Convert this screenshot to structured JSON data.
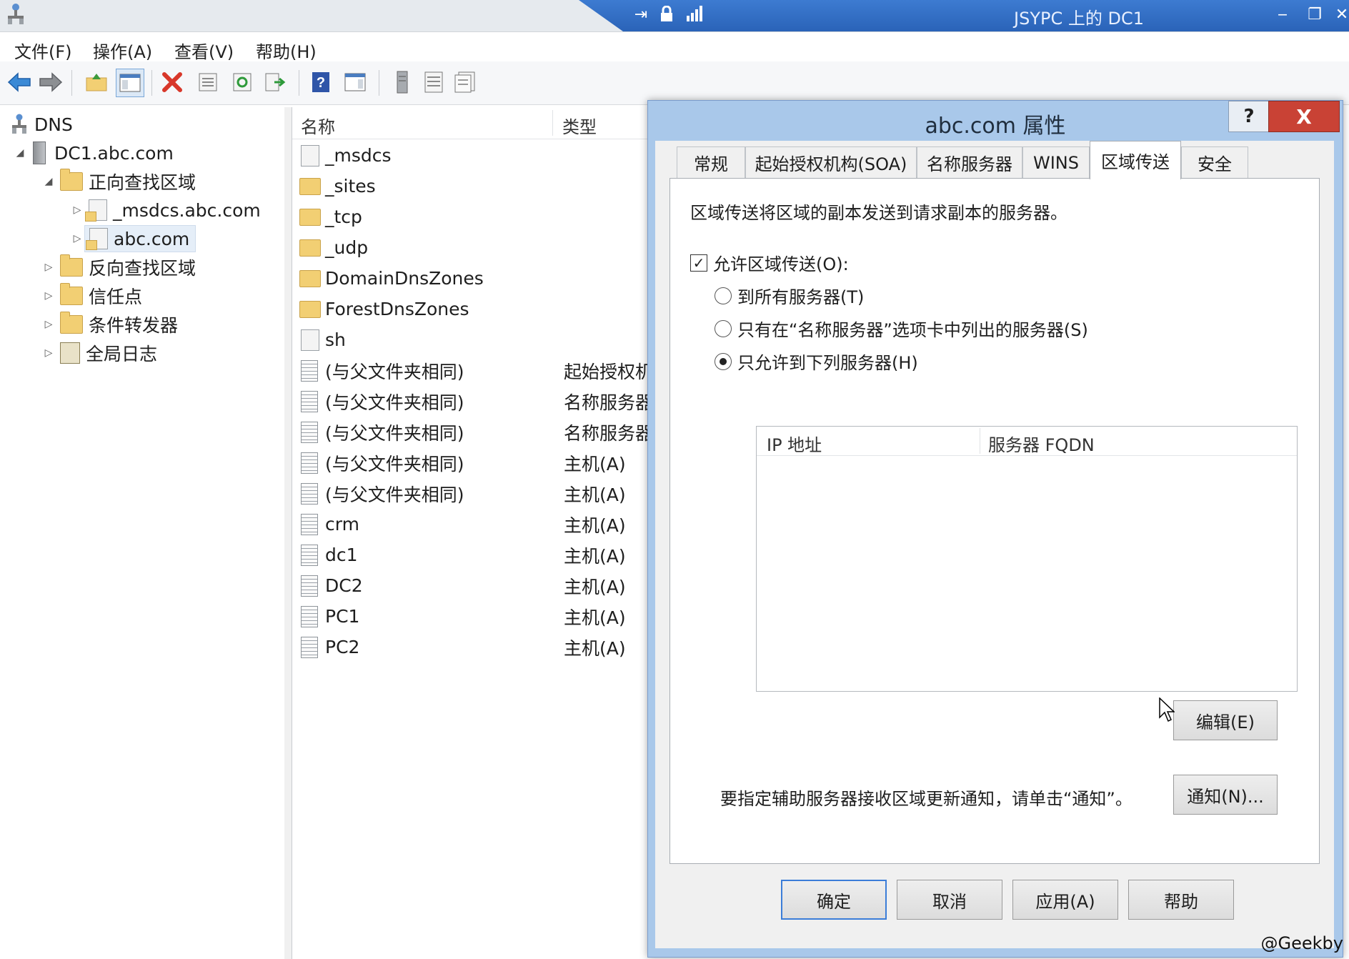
{
  "window": {
    "remote_title": "JSYPC 上的 DC1"
  },
  "menu": [
    "文件(F)",
    "操作(A)",
    "查看(V)",
    "帮助(H)"
  ],
  "toolbar": {
    "icons": [
      "back-icon",
      "forward-icon",
      "up-folder-icon",
      "show-hide-tree-icon",
      "delete-icon",
      "properties-icon",
      "refresh-icon",
      "export-icon",
      "help-icon",
      "action-pane-icon",
      "server-icon",
      "list-icon",
      "detail-icon"
    ]
  },
  "tree": {
    "root": "DNS",
    "server": "DC1.abc.com",
    "forward_zones": "正向查找区域",
    "msdcs_zone": "_msdcs.abc.com",
    "abc_zone": "abc.com",
    "reverse_zones": "反向查找区域",
    "trust_points": "信任点",
    "conditional_forwarders": "条件转发器",
    "global_logs": "全局日志"
  },
  "list": {
    "columns": [
      "名称",
      "类型"
    ],
    "rows": [
      {
        "name": "_msdcs",
        "type": "",
        "icon": "zone"
      },
      {
        "name": "_sites",
        "type": "",
        "icon": "folder"
      },
      {
        "name": "_tcp",
        "type": "",
        "icon": "folder"
      },
      {
        "name": "_udp",
        "type": "",
        "icon": "folder"
      },
      {
        "name": "DomainDnsZones",
        "type": "",
        "icon": "folder"
      },
      {
        "name": "ForestDnsZones",
        "type": "",
        "icon": "folder"
      },
      {
        "name": "sh",
        "type": "",
        "icon": "zone"
      },
      {
        "name": "(与父文件夹相同)",
        "type": "起始授权机",
        "icon": "record"
      },
      {
        "name": "(与父文件夹相同)",
        "type": "名称服务器",
        "icon": "record"
      },
      {
        "name": "(与父文件夹相同)",
        "type": "名称服务器",
        "icon": "record"
      },
      {
        "name": "(与父文件夹相同)",
        "type": "主机(A)",
        "icon": "record"
      },
      {
        "name": "(与父文件夹相同)",
        "type": "主机(A)",
        "icon": "record"
      },
      {
        "name": "crm",
        "type": "主机(A)",
        "icon": "record"
      },
      {
        "name": "dc1",
        "type": "主机(A)",
        "icon": "record"
      },
      {
        "name": "DC2",
        "type": "主机(A)",
        "icon": "record"
      },
      {
        "name": "PC1",
        "type": "主机(A)",
        "icon": "record"
      },
      {
        "name": "PC2",
        "type": "主机(A)",
        "icon": "record"
      }
    ]
  },
  "dialog": {
    "title": "abc.com 属性",
    "help_button": "?",
    "close_button": "X",
    "tabs": [
      "常规",
      "起始授权机构(SOA)",
      "名称服务器",
      "WINS",
      "区域传送",
      "安全"
    ],
    "active_tab": "区域传送",
    "description": "区域传送将区域的副本发送到请求副本的服务器。",
    "allow_transfer": {
      "label": "允许区域传送(O):",
      "checked": true
    },
    "options": [
      {
        "label": "到所有服务器(T)",
        "selected": false
      },
      {
        "label": "只有在“名称服务器”选项卡中列出的服务器(S)",
        "selected": false
      },
      {
        "label": "只允许到下列服务器(H)",
        "selected": true
      }
    ],
    "server_table": {
      "columns": [
        "IP 地址",
        "服务器 FQDN"
      ],
      "rows": []
    },
    "edit_button": "编辑(E)",
    "notify_text": "要指定辅助服务器接收区域更新通知，请单击“通知”。",
    "notify_button": "通知(N)...",
    "footer_buttons": {
      "ok": "确定",
      "cancel": "取消",
      "apply": "应用(A)",
      "help": "帮助"
    }
  },
  "watermark": "@Geekby"
}
